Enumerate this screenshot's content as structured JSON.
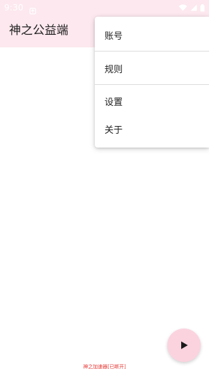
{
  "status_bar": {
    "time": "9:30",
    "notification_icon": "notification-icon",
    "wifi_icon": "wifi-icon",
    "signal_icon": "cell-signal-icon",
    "battery_icon": "battery-icon"
  },
  "app_bar": {
    "title": "神之公益端"
  },
  "menu": {
    "items": [
      {
        "label": "账号"
      },
      {
        "label": "规则"
      },
      {
        "label": "设置"
      },
      {
        "label": "关于"
      }
    ]
  },
  "fab": {
    "icon": "play-icon"
  },
  "footer": {
    "status_text": "神之加速器[已断开]"
  },
  "colors": {
    "app_bar_bg": "#fce8ee",
    "fab_bg": "#fbd3df",
    "footer_text": "#e53935"
  }
}
